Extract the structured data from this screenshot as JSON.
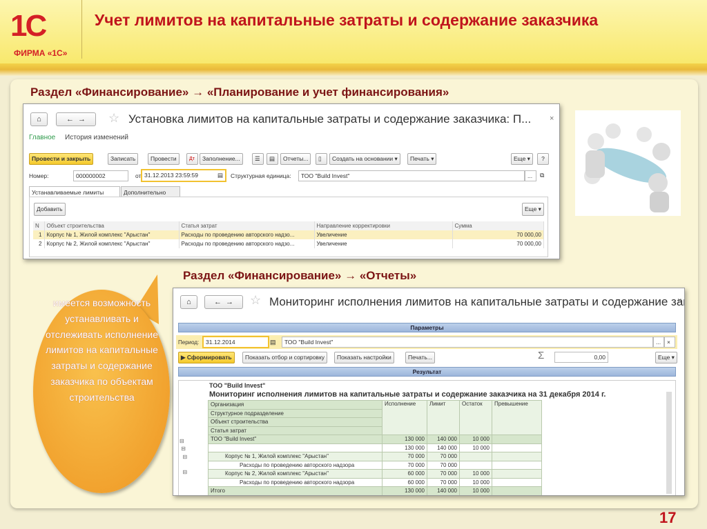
{
  "header": {
    "title": "Учет лимитов на капитальные затраты и содержание заказчика",
    "logo_text": "1С",
    "logo_caption": "ФИРМА «1С»"
  },
  "section1": "Раздел «Финансирование» → «Планирование и учет финансирования»",
  "section2": "Раздел «Финансирование» → «Отчеты»",
  "win1": {
    "title": "Установка лимитов на капитальные затраты и содержание заказчика: П...",
    "close": "×",
    "tabs_top": [
      "Главное",
      "История изменений"
    ],
    "toolbar": [
      "Провести и закрыть",
      "Записать",
      "Провести",
      "Заполнение...",
      "Отчеты...",
      "Создать на основании ▾",
      "Печать ▾",
      "Еще ▾",
      "?"
    ],
    "number_label": "Номер:",
    "number": "000000002",
    "date_label": "от:",
    "date": "31.12.2013 23:59:59",
    "unit_label": "Структурная единица:",
    "unit": "ТОО \"Build Invest\"",
    "tabs": [
      "Устанавливаемые лимиты",
      "Дополнительно"
    ],
    "add": "Добавить",
    "more": "Еще ▾",
    "columns": [
      "N",
      "Объект строительства",
      "Статья затрат",
      "Направление корректировки",
      "Сумма"
    ],
    "rows": [
      [
        "1",
        "Корпус № 1, Жилой комплекс \"Арыстан\"",
        "Расходы по проведению авторского надзо...",
        "Увеличение",
        "70 000,00"
      ],
      [
        "2",
        "Корпус № 2, Жилой комплекс \"Арыстан\"",
        "Расходы по проведению авторского надзо...",
        "Увеличение",
        "70 000,00"
      ]
    ]
  },
  "win2": {
    "title": "Мониторинг исполнения лимитов на капитальные затраты и содержание зака...",
    "close": "×",
    "params": "Параметры",
    "period_label": "Период:",
    "period": "31.12.2014",
    "org": "ТОО \"Build Invest\"",
    "buttons": [
      "▶ Сформировать",
      "Показать отбор и сортировку",
      "Показать настройки",
      "Печать...",
      "Еще ▾"
    ],
    "sum_icon": "Σ",
    "sum": "0,00",
    "result": "Результат",
    "report_org": "ТОО \"Build Invest\"",
    "report_title": "Мониторинг исполнения лимитов на капитальные затраты и содержание заказчика на 31 декабря 2014 г.",
    "group_headers": [
      "Организация",
      "Структурное подразделение",
      "Объект строительства",
      "Статья затрат"
    ],
    "columns": [
      "Исполнение",
      "Лимит",
      "Остаток",
      "Превышение"
    ],
    "rows": [
      [
        "ТОО \"Build Invest\"",
        "130 000",
        "140 000",
        "10 000",
        ""
      ],
      [
        "",
        "130 000",
        "140 000",
        "10 000",
        ""
      ],
      [
        "Корпус № 1, Жилой комплекс \"Арыстан\"",
        "70 000",
        "70 000",
        "",
        ""
      ],
      [
        "Расходы по проведению авторского надзора",
        "70 000",
        "70 000",
        "",
        ""
      ],
      [
        "Корпус № 2, Жилой комплекс \"Арыстан\"",
        "60 000",
        "70 000",
        "10 000",
        ""
      ],
      [
        "Расходы по проведению авторского надзора",
        "60 000",
        "70 000",
        "10 000",
        ""
      ]
    ],
    "total": [
      "Итого",
      "130 000",
      "140 000",
      "10 000",
      ""
    ]
  },
  "bubble": "имеется возможность устанавливать и отслеживать исполнение лимитов на капитальные затраты и содержание заказчика по объектам строительства",
  "page_number": "17"
}
